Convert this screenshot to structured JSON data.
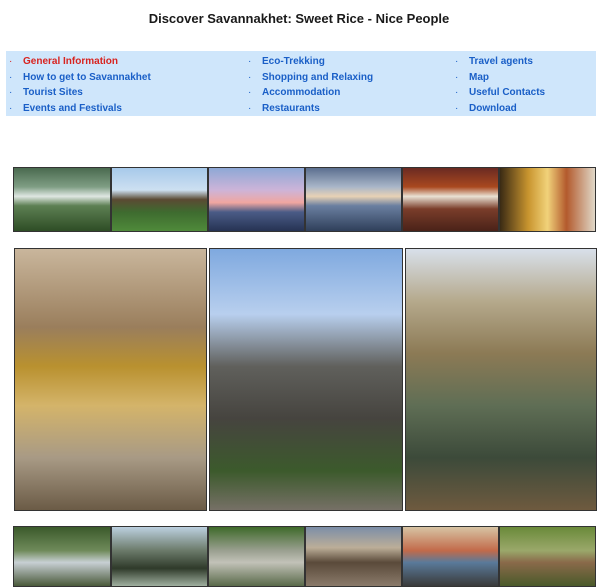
{
  "page": {
    "title": "Discover Savannakhet: Sweet Rice - Nice People"
  },
  "nav": {
    "bullet": "·",
    "columns": [
      [
        {
          "label": "General Information",
          "active": true
        },
        {
          "label": "How to get to Savannakhet",
          "active": false
        },
        {
          "label": "Tourist Sites",
          "active": false
        },
        {
          "label": "Events and Festivals",
          "active": false
        }
      ],
      [
        {
          "label": "Eco-Trekking",
          "active": false
        },
        {
          "label": "Shopping and Relaxing",
          "active": false
        },
        {
          "label": "Accommodation",
          "active": false
        },
        {
          "label": "Restaurants",
          "active": false
        }
      ],
      [
        {
          "label": "Travel agents",
          "active": false
        },
        {
          "label": "Map",
          "active": false
        },
        {
          "label": "Useful Contacts",
          "active": false
        },
        {
          "label": "Download",
          "active": false
        }
      ]
    ]
  },
  "colors": {
    "nav_background": "#cfe6fb",
    "link": "#1a5fc7",
    "active_link": "#d8231f"
  },
  "photos": {
    "top_strip": [
      "waterfall-photo",
      "temple-house-photo",
      "sunset-river-photo",
      "mekong-boat-photo",
      "temple-sign-photo",
      "buddha-row-photo"
    ],
    "feature": [
      "golden-buddha-photo",
      "that-ing-hang-stupa-photo",
      "old-shophouse-photo"
    ],
    "bottom_strip": [
      "forest-shrine-photo",
      "rock-formation-photo",
      "stone-cliff-photo",
      "hiker-photo",
      "villagers-photo",
      "monkey-photo"
    ]
  }
}
